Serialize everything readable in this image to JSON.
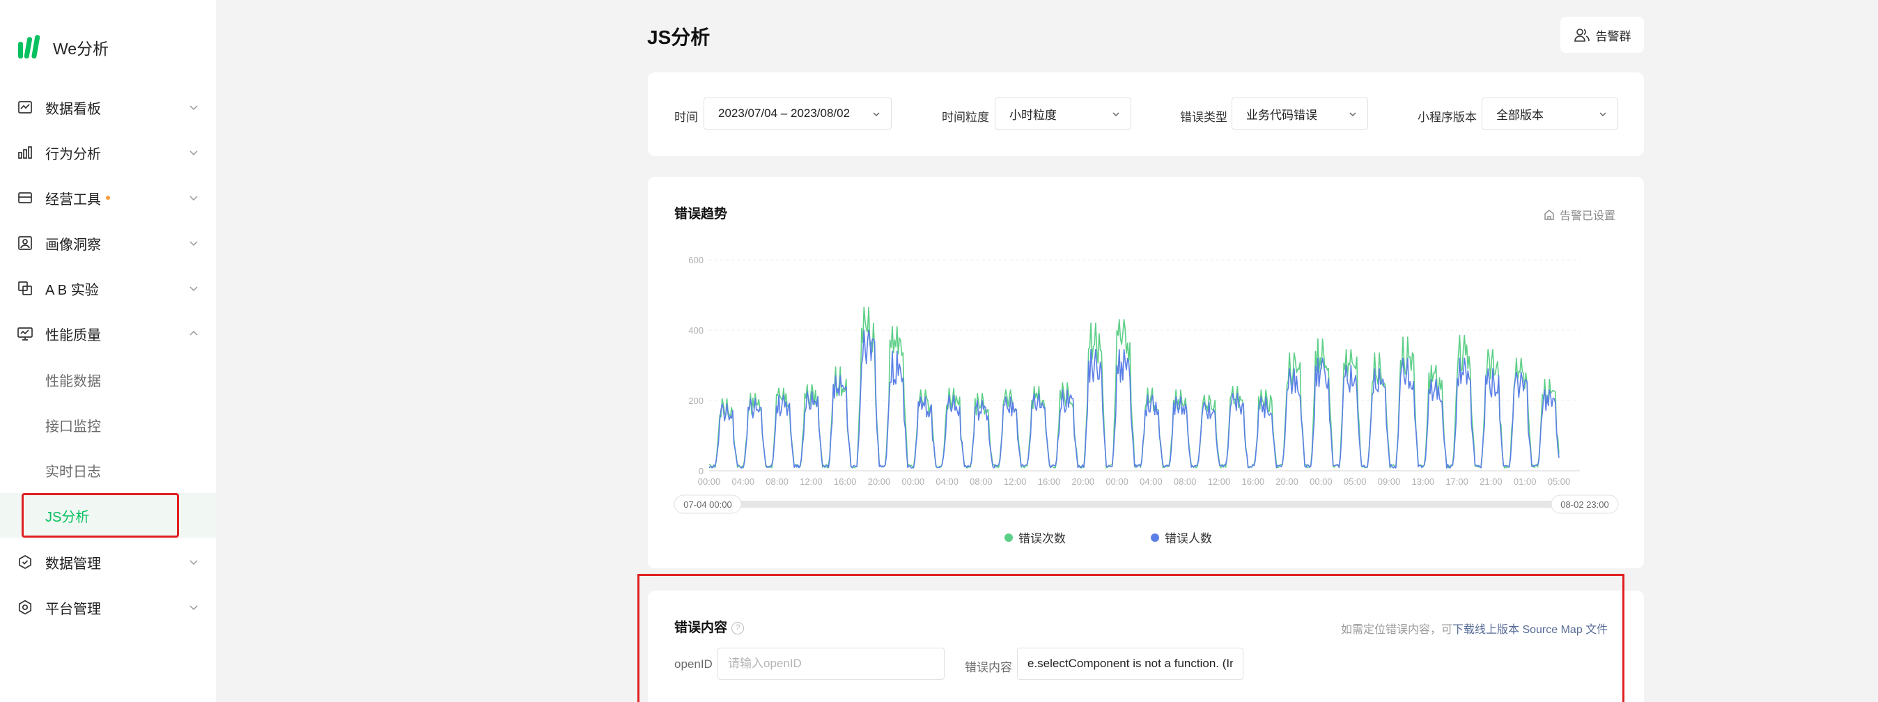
{
  "app": {
    "name": "We分析"
  },
  "sidebar": {
    "items": [
      {
        "label": "数据看板",
        "icon": "dashboard-icon"
      },
      {
        "label": "行为分析",
        "icon": "bar-chart-icon"
      },
      {
        "label": "经营工具",
        "icon": "store-icon",
        "badge_dot": true
      },
      {
        "label": "画像洞察",
        "icon": "user-portrait-icon"
      },
      {
        "label": "A B 实验",
        "icon": "ab-test-icon"
      },
      {
        "label": "性能质量",
        "icon": "monitor-icon",
        "expanded": true
      },
      {
        "label": "数据管理",
        "icon": "data-shield-icon"
      },
      {
        "label": "平台管理",
        "icon": "settings-hex-icon"
      }
    ],
    "sub_items": [
      {
        "label": "性能数据"
      },
      {
        "label": "接口监控"
      },
      {
        "label": "实时日志"
      },
      {
        "label": "JS分析",
        "active": true
      }
    ]
  },
  "header": {
    "title": "JS分析",
    "alert_group_label": "告警群"
  },
  "filters": {
    "time_label": "时间",
    "time_value": "2023/07/04 – 2023/08/02",
    "granularity_label": "时间粒度",
    "granularity_value": "小时粒度",
    "error_type_label": "错误类型",
    "error_type_value": "业务代码错误",
    "version_label": "小程序版本",
    "version_value": "全部版本"
  },
  "trend": {
    "title": "错误趋势",
    "alert_set_label": "告警已设置",
    "range_start": "07-04 00:00",
    "range_end": "08-02 23:00"
  },
  "content": {
    "title": "错误内容",
    "help_glyph": "?",
    "hint_prefix": "如需定位错误内容，可",
    "hint_link": "下载线上版本 Source Map 文件",
    "openid_label": "openID",
    "openid_placeholder": "请输入openID",
    "error_label": "错误内容",
    "error_value": "e.selectComponent is not a function. (In"
  },
  "colors": {
    "accent": "#07c160",
    "error_count": "#5ccf87",
    "error_users": "#5b7fe6",
    "highlight": "#e02020"
  },
  "chart_data": {
    "type": "line",
    "ylim": [
      0,
      600
    ],
    "yticks": [
      0,
      200,
      400,
      600
    ],
    "xticks": [
      "00:00",
      "04:00",
      "08:00",
      "12:00",
      "16:00",
      "20:00",
      "00:00",
      "04:00",
      "08:00",
      "12:00",
      "16:00",
      "20:00",
      "00:00",
      "04:00",
      "08:00",
      "12:00",
      "16:00",
      "20:00",
      "00:00",
      "05:00",
      "09:00",
      "13:00",
      "17:00",
      "21:00",
      "01:00",
      "05:00"
    ],
    "grid": true,
    "legend_position": "bottom",
    "series": [
      {
        "name": "错误次数",
        "color": "#5ccf87",
        "daily_peaks": [
          205,
          220,
          235,
          245,
          295,
          465,
          410,
          230,
          235,
          220,
          230,
          240,
          250,
          420,
          430,
          235,
          230,
          215,
          240,
          230,
          335,
          375,
          345,
          335,
          380,
          300,
          385,
          345,
          320,
          260
        ]
      },
      {
        "name": "错误人数",
        "color": "#5b7fe6",
        "daily_peaks": [
          190,
          205,
          215,
          225,
          270,
          400,
          340,
          210,
          215,
          200,
          210,
          220,
          230,
          345,
          345,
          215,
          210,
          195,
          220,
          210,
          290,
          320,
          300,
          290,
          320,
          260,
          320,
          290,
          280,
          230
        ]
      }
    ]
  }
}
